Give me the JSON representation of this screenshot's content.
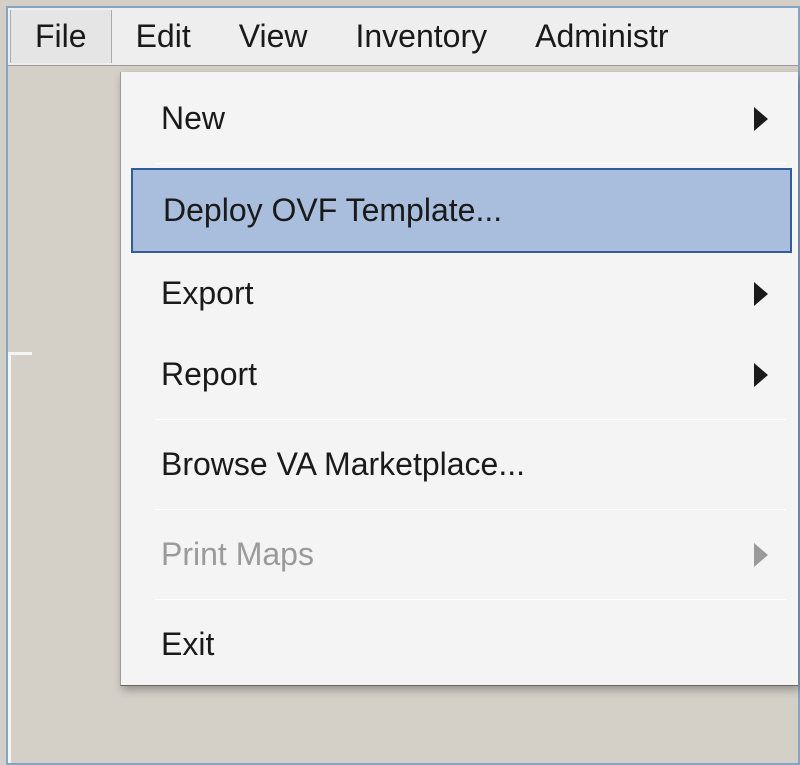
{
  "menubar": {
    "items": [
      {
        "label": "File"
      },
      {
        "label": "Edit"
      },
      {
        "label": "View"
      },
      {
        "label": "Inventory"
      },
      {
        "label": "Administr"
      }
    ]
  },
  "file_menu": {
    "new": "New",
    "deploy_ovf": "Deploy OVF Template...",
    "export": "Export",
    "report": "Report",
    "browse_va": "Browse VA Marketplace...",
    "print_maps": "Print Maps",
    "exit": "Exit"
  }
}
